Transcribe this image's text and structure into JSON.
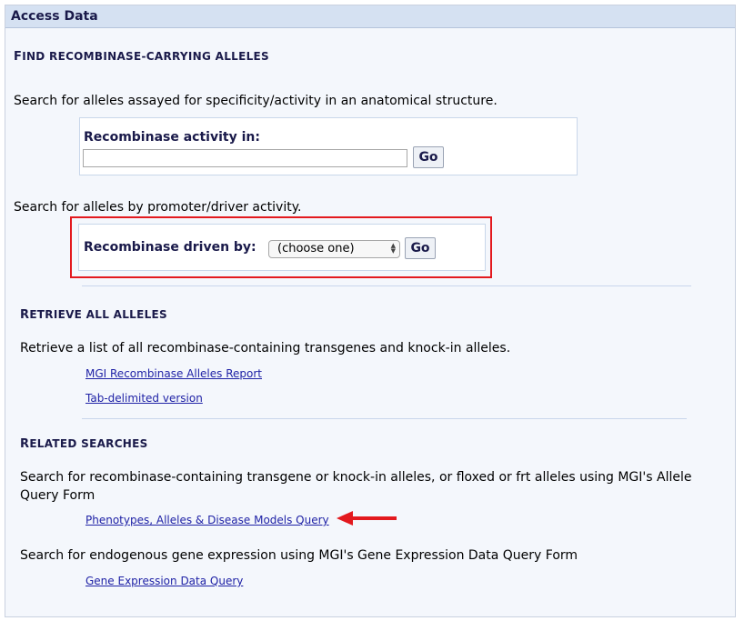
{
  "header": {
    "title": "Access Data"
  },
  "find_section": {
    "title_first": "F",
    "title_rest": "IND RECOMBINASE-CARRYING ALLELES",
    "anatomy_description": "Search for alleles assayed for specificity/activity in an anatomical structure.",
    "activity_label": "Recombinase activity in:",
    "activity_input_value": "",
    "go_label": "Go",
    "driver_description": "Search for alleles by promoter/driver activity.",
    "driver_label": "Recombinase driven by:",
    "driver_selected": "(choose one)",
    "driver_go_label": "Go"
  },
  "retrieve_section": {
    "title_first": "R",
    "title_rest": "ETRIEVE ALL ALLELES",
    "description": "Retrieve a list of all recombinase-containing transgenes and knock-in alleles.",
    "links": [
      "MGI Recombinase Alleles Report",
      "Tab-delimited version"
    ]
  },
  "related_section": {
    "title_first": "R",
    "title_rest": "ELATED SEARCHES",
    "allele_description_line1": "Search for recombinase-containing transgene or knock-in alleles, or floxed or frt alleles using MGI's Allele",
    "allele_description_line2": "Query Form",
    "allele_link": "Phenotypes, Alleles & Disease Models Query",
    "expression_description": "Search for endogenous gene expression using MGI's Gene Expression Data Query Form",
    "expression_link": "Gene Expression Data Query"
  },
  "colors": {
    "highlight": "#e3191e",
    "link": "#1f22a6",
    "header_bg": "#d5e1f2",
    "panel_bg": "#f4f7fc"
  }
}
